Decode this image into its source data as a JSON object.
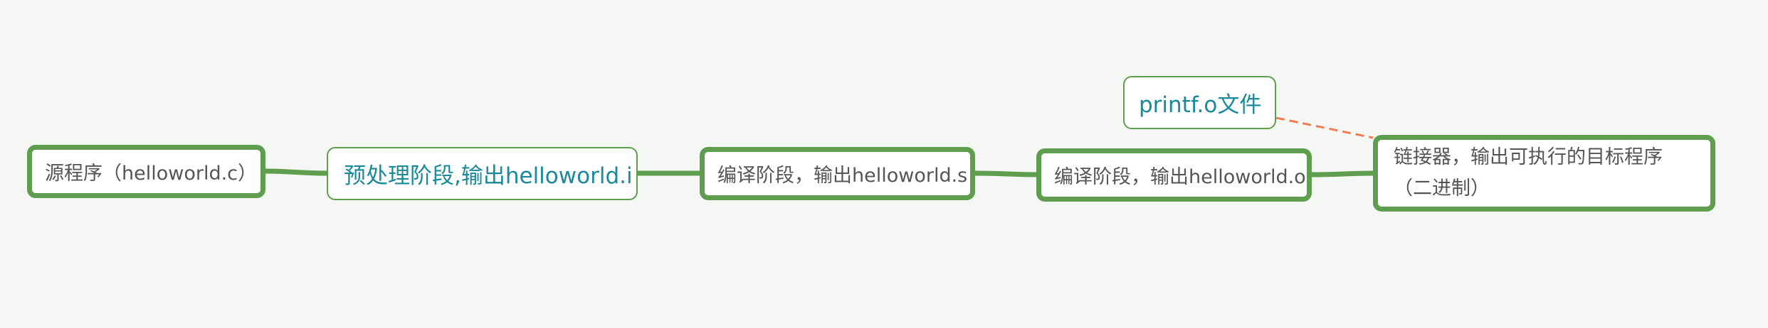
{
  "diagram": {
    "nodes": [
      {
        "id": "source",
        "label": "源程序（helloworld.c）"
      },
      {
        "id": "preprocess",
        "label": "预处理阶段,输出helloworld.i"
      },
      {
        "id": "compile_s",
        "label": "编译阶段，输出helloworld.s"
      },
      {
        "id": "compile_o",
        "label": "编译阶段，输出helloworld.o"
      },
      {
        "id": "linker",
        "label": "链接器，输出可执行的目标程序（二进制）"
      },
      {
        "id": "printf",
        "label": "printf.o文件"
      }
    ],
    "edges": [
      {
        "from": "source",
        "to": "preprocess",
        "style": "solid"
      },
      {
        "from": "preprocess",
        "to": "compile_s",
        "style": "solid"
      },
      {
        "from": "compile_s",
        "to": "compile_o",
        "style": "solid"
      },
      {
        "from": "compile_o",
        "to": "linker",
        "style": "solid"
      },
      {
        "from": "printf",
        "to": "linker",
        "style": "dashed"
      }
    ],
    "colors": {
      "background": "#f5f7f4",
      "node_border": "#5f9e4e",
      "connector": "#5f9e4e",
      "relation": "#f07c4f",
      "node_text": "#555555",
      "accent_text": "#1a8a9a"
    }
  }
}
